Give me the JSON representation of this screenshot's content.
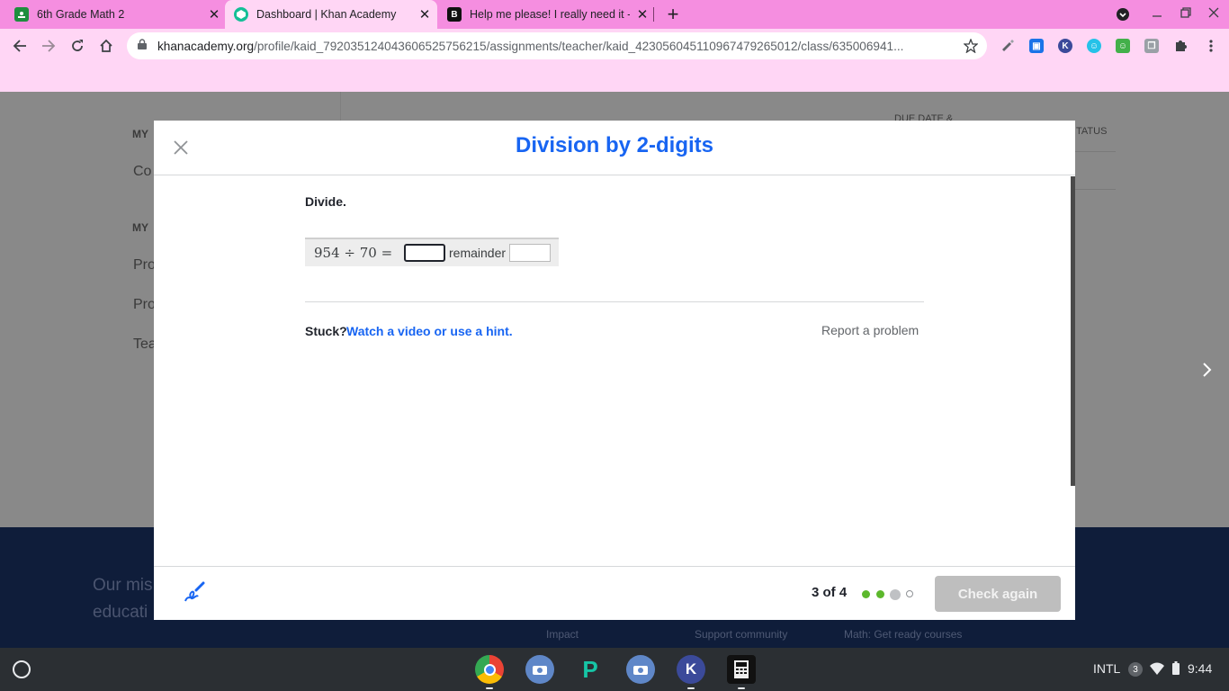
{
  "browser": {
    "tabs": [
      {
        "title": "6th Grade Math 2",
        "favicon": "google-classroom-icon",
        "active": false
      },
      {
        "title": "Dashboard | Khan Academy",
        "favicon": "khan-academy-icon",
        "active": true
      },
      {
        "title": "Help me please! I really need it - B",
        "favicon": "brainly-icon",
        "active": false
      }
    ],
    "url_host": "khanacademy.org",
    "url_path": "/profile/kaid_792035124043606525756215/assignments/teacher/kaid_423056045110967479265012/class/635006941..."
  },
  "background_page": {
    "side_labels": [
      "MY",
      "Co",
      "MY",
      "Pro",
      "Pro",
      "Tea"
    ],
    "column_headers": [
      "DUE DATE &",
      "TATUS"
    ],
    "footer_mission_lines": [
      "Our mis",
      "educati"
    ],
    "footer_links": [
      "Impact",
      "Support community",
      "Math: Get ready courses"
    ]
  },
  "modal": {
    "title": "Division by 2-digits",
    "prompt": "Divide.",
    "equation": "954 ÷ 70 =",
    "remainder_label": "remainder",
    "quotient_value": "",
    "remainder_value": "",
    "stuck_label": "Stuck?",
    "hint_link": "Watch a video or use a hint.",
    "report_link": "Report a problem",
    "progress_text": "3 of 4",
    "progress_dots": [
      "complete",
      "complete",
      "current",
      "empty"
    ],
    "check_button": "Check again"
  },
  "shelf": {
    "status_label": "INTL",
    "notification_count": "3",
    "time": "9:44"
  },
  "colors": {
    "tab_strip": "#f58ee0",
    "toolbar": "#ffd6f5",
    "khan_blue": "#1865f2",
    "progress_green": "#5cb82c"
  }
}
